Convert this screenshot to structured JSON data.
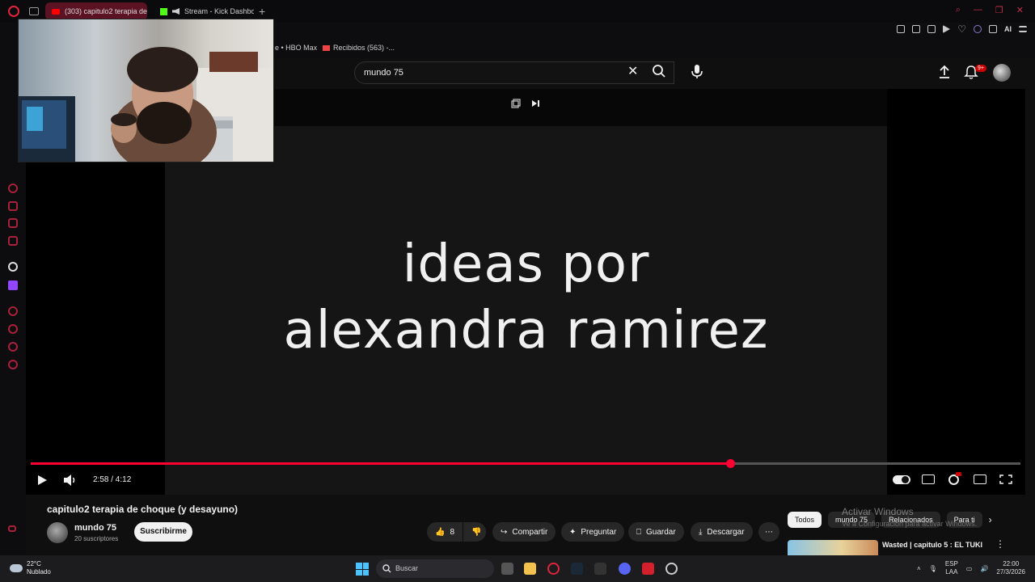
{
  "browser": {
    "tabs": [
      {
        "title": "(303) capitulo2 terapia de",
        "active": true
      },
      {
        "title": "Stream - Kick Dashbo",
        "active": false
      }
    ],
    "bookmarks": [
      "e • HBO Max",
      "Recibidos (563) -..."
    ],
    "toolbar_ai_label": "AI"
  },
  "youtube": {
    "search_query": "mundo 75",
    "notification_badge": "9+"
  },
  "video": {
    "overlay_text_line1": "ideas por",
    "overlay_text_line2": "alexandra ramirez",
    "current_time": "2:58",
    "duration": "4:12",
    "time_display": "2:58 / 4:12",
    "progress_fraction": 0.707,
    "accent_color": "#ff0033"
  },
  "details": {
    "title": "capitulo2 terapia de choque (y desayuno)",
    "channel": "mundo 75",
    "subscribers": "20 suscriptores",
    "subscribe_label": "Suscribirme",
    "like_count": "8",
    "share_label": "Compartir",
    "ask_label": "Preguntar",
    "save_label": "Guardar",
    "download_label": "Descargar"
  },
  "recommendations": {
    "chips": [
      "Todos",
      "mundo 75",
      "Relacionados",
      "Para ti"
    ],
    "first_title": "Wasted | capitulo 5 : EL TUKI"
  },
  "watermark": {
    "line1": "Activar Windows",
    "line2": "Ve a Configuración para activar Windows."
  },
  "taskbar": {
    "temperature": "22°C",
    "weather": "Nublado",
    "search_placeholder": "Buscar",
    "lang_line1": "ESP",
    "lang_line2": "LAA",
    "time": "22:00",
    "date": "27/3/2026"
  }
}
